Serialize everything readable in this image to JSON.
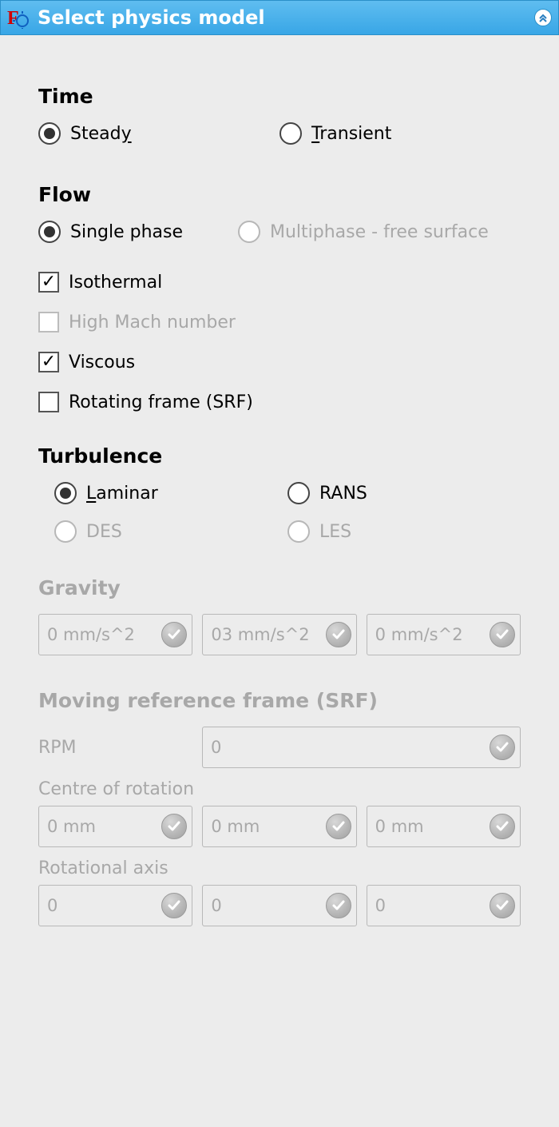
{
  "title": "Select physics model",
  "sections": {
    "time": {
      "heading": "Time",
      "options": {
        "steady": "Steady",
        "transient": "Transient"
      },
      "selected": "steady"
    },
    "flow": {
      "heading": "Flow",
      "phase": {
        "single": "Single phase",
        "multi": "Multiphase - free surface"
      },
      "phase_selected": "single",
      "isothermal": {
        "label": "Isothermal",
        "checked": true
      },
      "high_mach": {
        "label": "High Mach number",
        "checked": false,
        "disabled": true
      },
      "viscous": {
        "label": "Viscous",
        "checked": true
      },
      "srf": {
        "label": "Rotating frame (SRF)",
        "checked": false
      }
    },
    "turbulence": {
      "heading": "Turbulence",
      "options": {
        "laminar": "Laminar",
        "rans": "RANS",
        "des": "DES",
        "les": "LES"
      },
      "selected": "laminar",
      "disabled": [
        "des",
        "les"
      ]
    },
    "gravity": {
      "heading": "Gravity",
      "values": [
        "0 mm/s^2",
        "03 mm/s^2",
        "0 mm/s^2"
      ]
    },
    "srf_frame": {
      "heading": "Moving reference frame (SRF)",
      "rpm_label": "RPM",
      "rpm_value": "0",
      "centre_label": "Centre of rotation",
      "centre_values": [
        "0 mm",
        "0 mm",
        "0 mm"
      ],
      "axis_label": "Rotational axis",
      "axis_values": [
        "0",
        "0",
        "0"
      ]
    }
  }
}
